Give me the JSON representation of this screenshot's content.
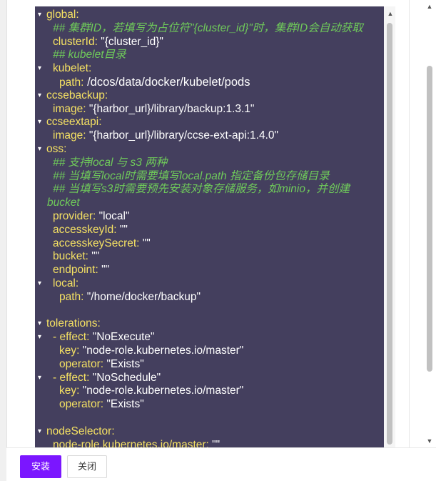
{
  "editor": {
    "lines": [
      {
        "fold": "▾",
        "key": "global:",
        "val": "",
        "cmt": ""
      },
      {
        "fold": "",
        "key": "",
        "val": "",
        "cmt": "## 集群ID，若填写为占位符\"{cluster_id}\"时，集群ID会自动获取"
      },
      {
        "fold": "",
        "key": "clusterId:",
        "val": " \"{cluster_id}\"",
        "cmt": ""
      },
      {
        "fold": "",
        "key": "",
        "val": "",
        "cmt": "## kubelet目录"
      },
      {
        "fold": "▾",
        "key": "kubelet:",
        "val": "",
        "cmt": ""
      },
      {
        "fold": "",
        "key": "path:",
        "val": " /dcos/data/docker/kubelet/pods",
        "cmt": ""
      },
      {
        "fold": "▾",
        "key": "ccsebackup:",
        "val": "",
        "cmt": ""
      },
      {
        "fold": "",
        "key": "image:",
        "val": " \"{harbor_url}/library/backup:1.3.1\"",
        "cmt": ""
      },
      {
        "fold": "▾",
        "key": "ccseextapi:",
        "val": "",
        "cmt": ""
      },
      {
        "fold": "",
        "key": "image:",
        "val": " \"{harbor_url}/library/ccse-ext-api:1.4.0\"",
        "cmt": ""
      },
      {
        "fold": "▾",
        "key": "oss:",
        "val": "",
        "cmt": ""
      },
      {
        "fold": "",
        "key": "",
        "val": "",
        "cmt": "## 支持local 与 s3 两种"
      },
      {
        "fold": "",
        "key": "",
        "val": "",
        "cmt": "## 当填写local时需要填写local.path 指定备份包存储目录"
      },
      {
        "fold": "",
        "key": "",
        "val": "",
        "cmt": "## 当填写s3时需要预先安装对象存储服务，如minio，并创建"
      },
      {
        "fold": "",
        "key": "",
        "val": "",
        "cmt": "bucket"
      },
      {
        "fold": "",
        "key": "provider:",
        "val": " \"local\"",
        "cmt": ""
      },
      {
        "fold": "",
        "key": "accesskeyId:",
        "val": " \"\"",
        "cmt": ""
      },
      {
        "fold": "",
        "key": "accesskeySecret:",
        "val": " \"\"",
        "cmt": ""
      },
      {
        "fold": "",
        "key": "bucket:",
        "val": " \"\"",
        "cmt": ""
      },
      {
        "fold": "",
        "key": "endpoint:",
        "val": " \"\"",
        "cmt": ""
      },
      {
        "fold": "▾",
        "key": "local:",
        "val": "",
        "cmt": ""
      },
      {
        "fold": "",
        "key": "path:",
        "val": " \"/home/docker/backup\"",
        "cmt": ""
      },
      {
        "fold": "",
        "key": "",
        "val": "",
        "cmt": ""
      },
      {
        "fold": "▾",
        "key": "tolerations:",
        "val": "",
        "cmt": ""
      },
      {
        "fold": "▾",
        "key": "- effect:",
        "val": " \"NoExecute\"",
        "cmt": ""
      },
      {
        "fold": "",
        "key": "key:",
        "val": " \"node-role.kubernetes.io/master\"",
        "cmt": ""
      },
      {
        "fold": "",
        "key": "operator:",
        "val": " \"Exists\"",
        "cmt": ""
      },
      {
        "fold": "▾",
        "key": "- effect:",
        "val": " \"NoSchedule\"",
        "cmt": ""
      },
      {
        "fold": "",
        "key": "key:",
        "val": " \"node-role.kubernetes.io/master\"",
        "cmt": ""
      },
      {
        "fold": "",
        "key": "operator:",
        "val": " \"Exists\"",
        "cmt": ""
      },
      {
        "fold": "",
        "key": "",
        "val": "",
        "cmt": ""
      },
      {
        "fold": "▾",
        "key": "nodeSelector:",
        "val": "",
        "cmt": ""
      },
      {
        "fold": "",
        "key": "node-role.kubernetes.io/master:",
        "val": " \"\"",
        "cmt": ""
      }
    ]
  },
  "footer": {
    "install_label": "安装",
    "close_label": "关闭"
  },
  "scrollbars": {
    "up_arrow": "▲",
    "down_arrow": "▼"
  },
  "colors": {
    "editor_bg": "#443f5e",
    "key": "#f5e163",
    "comment": "#6fca5a",
    "value": "#ffffff",
    "primary": "#7b16ff"
  }
}
